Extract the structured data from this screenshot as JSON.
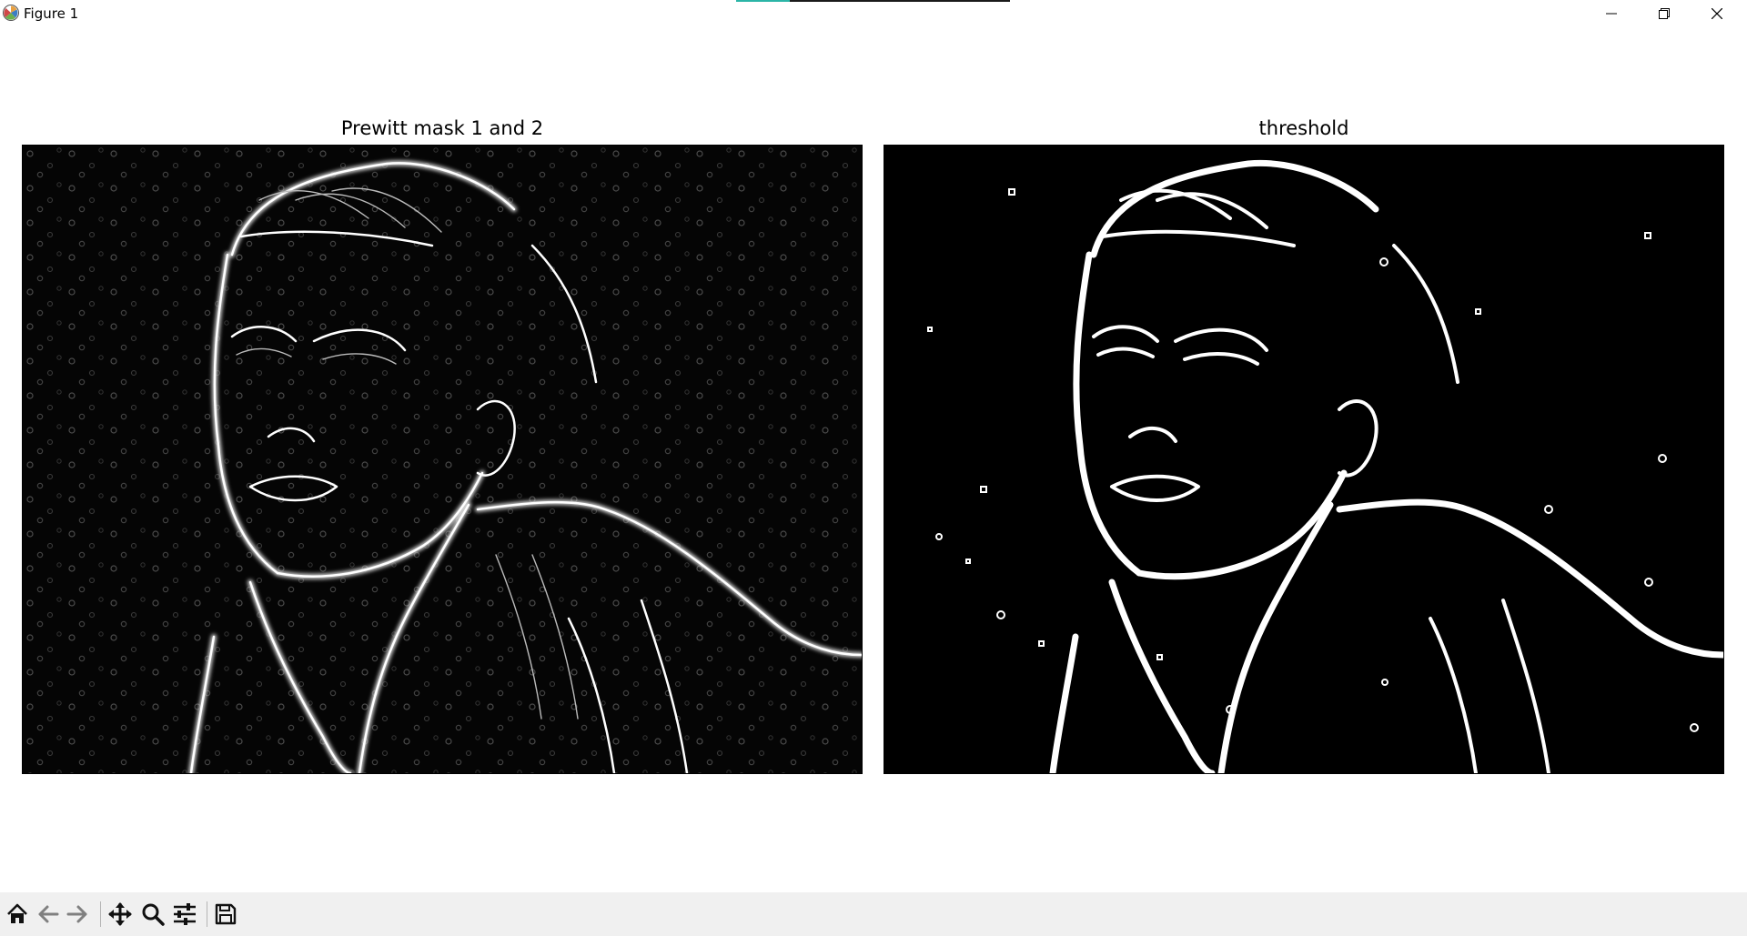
{
  "window": {
    "title": "Figure 1",
    "minimize_icon": "minimize-icon",
    "maximize_icon": "restore-icon",
    "close_icon": "close-icon"
  },
  "figure": {
    "left_axes": {
      "title": "Prewitt mask 1 and 2",
      "content": "edge-magnitude image (grayscale)"
    },
    "right_axes": {
      "title": "threshold",
      "content": "binary thresholded edge image"
    }
  },
  "toolbar": {
    "buttons": [
      {
        "name": "home",
        "icon": "home-icon"
      },
      {
        "name": "back",
        "icon": "arrow-left-icon"
      },
      {
        "name": "forward",
        "icon": "arrow-right-icon"
      },
      {
        "name": "pan",
        "icon": "move-icon"
      },
      {
        "name": "zoom",
        "icon": "magnifier-icon"
      },
      {
        "name": "configure-subplots",
        "icon": "sliders-icon"
      },
      {
        "name": "save",
        "icon": "floppy-disk-icon"
      }
    ]
  },
  "colors": {
    "toolbar_bg": "#f0f0f0",
    "accent": "#2bb5a7",
    "axes_bg": "#000000"
  }
}
